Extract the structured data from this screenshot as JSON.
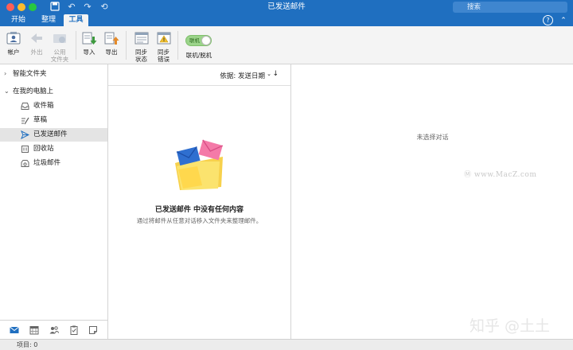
{
  "window": {
    "title": "已发送邮件"
  },
  "search": {
    "placeholder": "搜索"
  },
  "tabs": [
    {
      "label": "开始",
      "active": false
    },
    {
      "label": "整理",
      "active": false
    },
    {
      "label": "工具",
      "active": true
    }
  ],
  "ribbon": {
    "accounts": "帐户",
    "out_of_office": "外出",
    "public_folders_1": "公用",
    "public_folders_2": "文件夹",
    "import": "导入",
    "export": "导出",
    "sync_status_1": "同步",
    "sync_status_2": "状态",
    "sync_errors_1": "同步",
    "sync_errors_2": "错误",
    "online_toggle_label": "联机",
    "online_offline": "联机/脱机"
  },
  "sidebar": {
    "smart_folders": "智能文件夹",
    "on_my_computer": "在我的电脑上",
    "folders": [
      {
        "label": "收件箱",
        "icon": "inbox-icon",
        "selected": false
      },
      {
        "label": "草稿",
        "icon": "drafts-icon",
        "selected": false
      },
      {
        "label": "已发送邮件",
        "icon": "sent-icon",
        "selected": true
      },
      {
        "label": "回收站",
        "icon": "trash-icon",
        "selected": false
      },
      {
        "label": "垃圾邮件",
        "icon": "junk-icon",
        "selected": false
      }
    ]
  },
  "list": {
    "sort_label": "依据: 发送日期",
    "empty_title": "已发送邮件 中没有任何内容",
    "empty_subtitle": "通过将邮件从任意对话移入文件夹来整理邮件。"
  },
  "reading": {
    "no_selection": "未选择对话"
  },
  "watermarks": {
    "macz": "www.MacZ.com",
    "zhihu": "知乎 @土土"
  },
  "status": {
    "items": "项目: 0"
  },
  "colors": {
    "accent": "#1f6fc0",
    "toggle_on": "#9bd48a"
  }
}
